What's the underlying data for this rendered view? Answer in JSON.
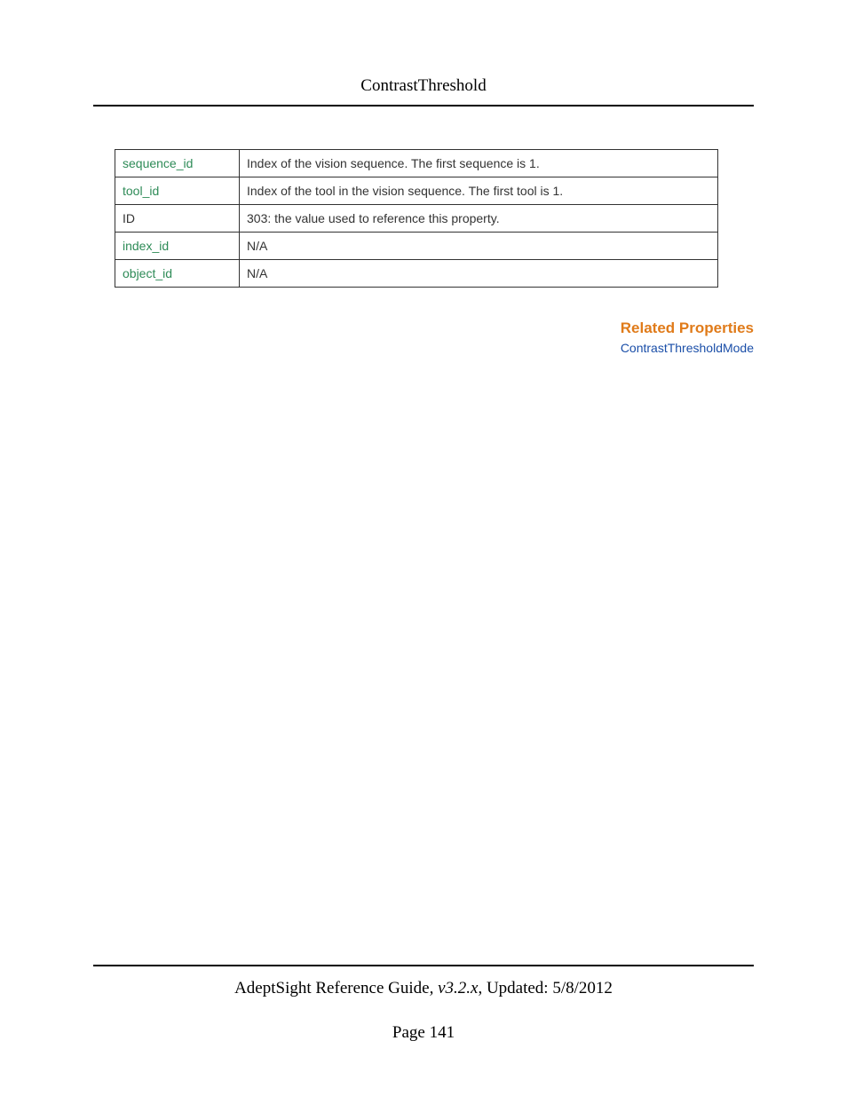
{
  "header": {
    "title": "ContrastThreshold"
  },
  "table": {
    "rows": [
      {
        "key": "sequence_id",
        "key_plain": false,
        "value": "Index of the vision sequence. The first sequence is 1."
      },
      {
        "key": "tool_id",
        "key_plain": false,
        "value": "Index of the tool in the vision sequence. The first tool is 1."
      },
      {
        "key": "ID",
        "key_plain": true,
        "value": "303: the value used to reference this property."
      },
      {
        "key": "index_id",
        "key_plain": false,
        "value": "N/A"
      },
      {
        "key": "object_id",
        "key_plain": false,
        "value": "N/A"
      }
    ]
  },
  "related": {
    "heading": "Related Properties",
    "links": [
      "ContrastThresholdMode"
    ]
  },
  "footer": {
    "doc_title": "AdeptSight Reference Guide",
    "version": ", v3.2.x",
    "updated_label": ", Updated: ",
    "updated_date": "5/8/2012",
    "page_label": "Page ",
    "page_number": "141"
  }
}
